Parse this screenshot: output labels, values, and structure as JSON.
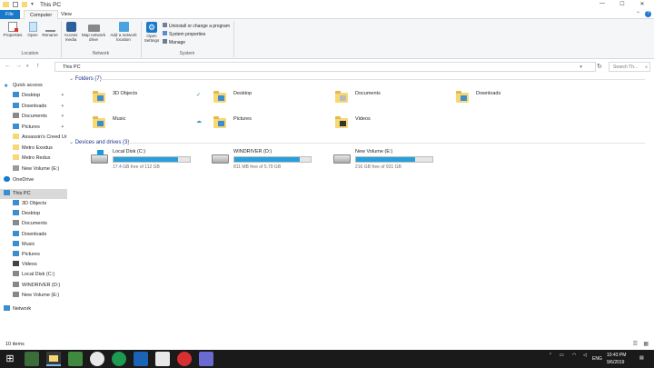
{
  "window": {
    "title": "This PC",
    "controls": [
      "minimize-icon",
      "maximize-icon",
      "close-icon"
    ]
  },
  "ribbon": {
    "tabs": [
      "File",
      "Computer",
      "View"
    ],
    "properties": "Properties",
    "open": "Open",
    "rename": "Rename",
    "access_media": "Access media",
    "map_network_drive": "Map network drive",
    "add_network_location": "Add a network location",
    "open_settings": "Open Settings",
    "uninstall": "Uninstall or change a program",
    "system_properties": "System properties",
    "manage": "Manage",
    "groups": [
      "Location",
      "Network",
      "System"
    ]
  },
  "address": {
    "path": "This PC",
    "search_placeholder": "Search Th..."
  },
  "sidebar": {
    "quick_access": "Quick access",
    "quick_items": [
      {
        "label": "Desktop",
        "pinned": true
      },
      {
        "label": "Downloads",
        "pinned": true
      },
      {
        "label": "Documents",
        "pinned": true
      },
      {
        "label": "Pictures",
        "pinned": true
      },
      {
        "label": "Assassin's Creed Ur",
        "pinned": false
      },
      {
        "label": "Metro Exodus",
        "pinned": false
      },
      {
        "label": "Metro Redux",
        "pinned": false
      },
      {
        "label": "New Volume (E:)",
        "pinned": false
      }
    ],
    "onedrive": "OneDrive",
    "this_pc": "This PC",
    "pc_items": [
      "3D Objects",
      "Desktop",
      "Documents",
      "Downloads",
      "Music",
      "Pictures",
      "Videos",
      "Local Disk (C:)",
      "WINDRIVER (D:)",
      "New Volume (E:)"
    ],
    "network": "Network"
  },
  "content": {
    "folders_header": "Folders (7)",
    "folders": [
      "3D Objects",
      "Desktop",
      "Documents",
      "Downloads",
      "Music",
      "Pictures",
      "Videos"
    ],
    "drives_header": "Devices and drives (3)",
    "drives": [
      {
        "name": "Local Disk (C:)",
        "info": "17.4 GB free of 112 GB",
        "used": 0.845
      },
      {
        "name": "WINDRIVER (D:)",
        "info": "811 MB free of 5.79 GB",
        "used": 0.86
      },
      {
        "name": "New Volume (E:)",
        "info": "216 GB free of 931 GB",
        "used": 0.77
      }
    ]
  },
  "status": {
    "items": "10 items"
  },
  "taskbar": {
    "lang": "ENG",
    "time": "10:43 PM",
    "date": "9/6/2019"
  },
  "colors": {
    "accent": "#1979ca",
    "drive_fill": "#26a0da",
    "folder": "#f8d775",
    "taskbar": "#1a1a1a"
  }
}
